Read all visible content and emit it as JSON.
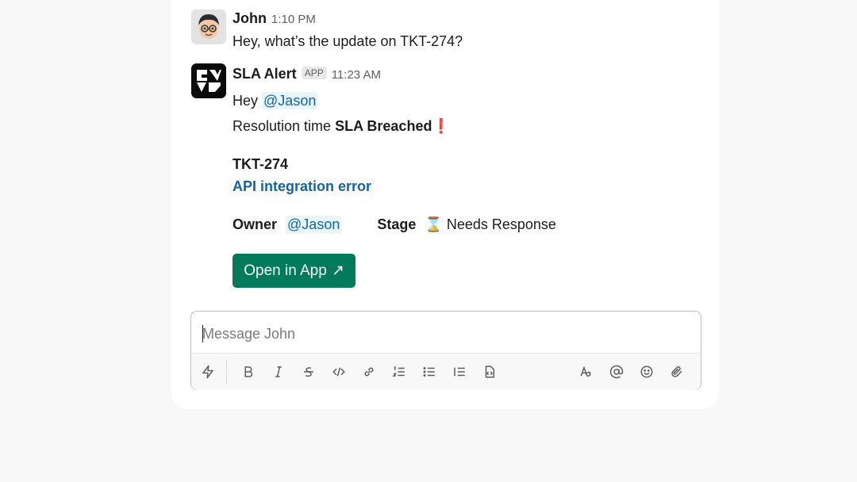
{
  "messages": [
    {
      "author": "John",
      "time": "1:10 PM",
      "text": "Hey, what’s the update on TKT-274?"
    },
    {
      "author": "SLA Alert",
      "badge": "APP",
      "time": "11:23 AM",
      "greeting": "Hey",
      "mention": "@Jason",
      "resolution_prefix": "Resolution time",
      "resolution_status": "SLA Breached",
      "alert_mark": "❗",
      "ticket_id": "TKT-274",
      "ticket_title": "API integration error",
      "owner_label": "Owner",
      "owner_value": "@Jason",
      "stage_label": "Stage",
      "stage_icon": "⌛",
      "stage_value": "Needs Response",
      "button_label": "Open in App",
      "button_icon": "↗"
    }
  ],
  "composer": {
    "placeholder": "Message John",
    "tools": [
      "shortcuts-icon",
      "bold-icon",
      "italic-icon",
      "strikethrough-icon",
      "code-icon",
      "link-icon",
      "ordered-list-icon",
      "bulleted-list-icon",
      "blockquote-icon",
      "code-block-icon",
      "formatting-icon",
      "mention-icon",
      "emoji-icon",
      "attach-icon"
    ]
  },
  "colors": {
    "accent_green": "#007a5a",
    "link_blue": "#1264a3",
    "alert_red": "#e01e5a"
  }
}
